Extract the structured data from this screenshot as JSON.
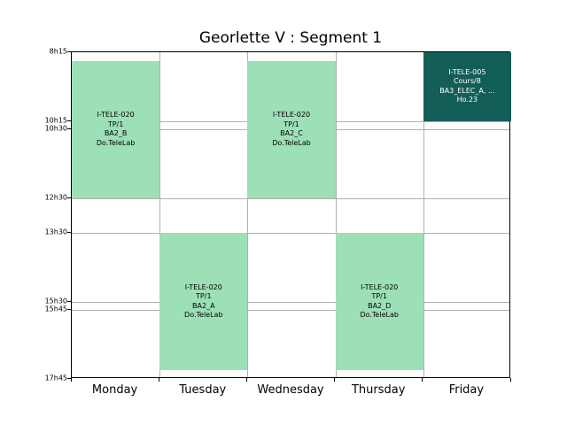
{
  "title": "Georlette V : Segment 1",
  "days": [
    "Monday",
    "Tuesday",
    "Wednesday",
    "Thursday",
    "Friday"
  ],
  "time_ticks": [
    "8h15",
    "10h15",
    "10h30",
    "12h30",
    "13h30",
    "15h30",
    "15h45",
    "17h45"
  ],
  "time_range": {
    "start": "8h15",
    "end": "17h45"
  },
  "colors": {
    "tp": "#9ddfb7",
    "cours": "#135e57"
  },
  "events": [
    {
      "day": "Monday",
      "start": "8h30",
      "end": "12h30",
      "text": "I-TELE-020\nTP/1\nBA2_B\nDo.TeleLab",
      "color": "tp",
      "text_color": "#000000"
    },
    {
      "day": "Tuesday",
      "start": "13h30",
      "end": "17h30",
      "text": "I-TELE-020\nTP/1\nBA2_A\nDo.TeleLab",
      "color": "tp",
      "text_color": "#000000"
    },
    {
      "day": "Wednesday",
      "start": "8h30",
      "end": "12h30",
      "text": "I-TELE-020\nTP/1\nBA2_C\nDo.TeleLab",
      "color": "tp",
      "text_color": "#000000"
    },
    {
      "day": "Thursday",
      "start": "13h30",
      "end": "17h30",
      "text": "I-TELE-020\nTP/1\nBA2_D\nDo.TeleLab",
      "color": "tp",
      "text_color": "#000000"
    },
    {
      "day": "Friday",
      "start": "8h15",
      "end": "10h15",
      "text": "I-TELE-005\nCours/8\nBA3_ELEC_A, ...\nHo.23",
      "color": "cours",
      "text_color": "#ffffff"
    }
  ]
}
